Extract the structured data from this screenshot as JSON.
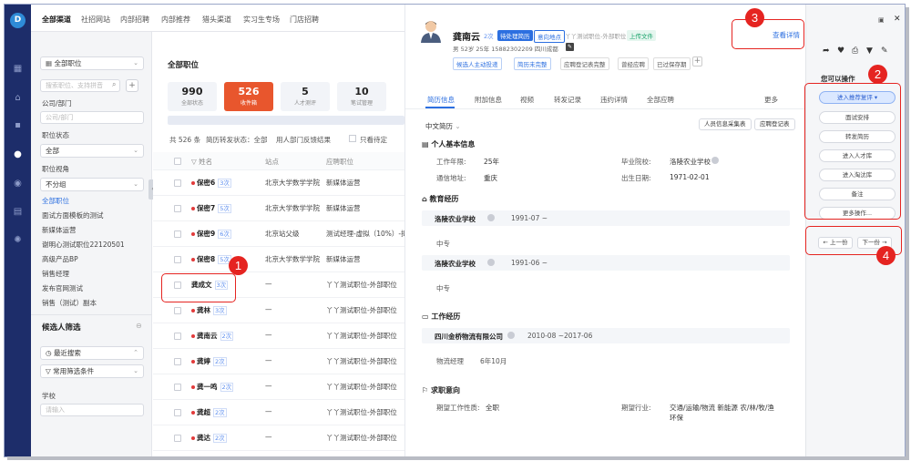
{
  "top_tabs": [
    "全部渠道",
    "社招网站",
    "内部招聘",
    "内部推荐",
    "猎头渠道",
    "实习生专场",
    "门店招聘"
  ],
  "filter": {
    "job_select": "全部职位",
    "search_placeholder": "搜索职位、支持拼音",
    "company_label": "公司/部门",
    "company_placeholder": "公司/部门",
    "status_label": "职位状态",
    "status_value": "全部",
    "view_label": "职位视角",
    "view_value": "不分组",
    "positions": [
      "全部职位",
      "面试方面模板的测试",
      "新媒体运营",
      "谢明心测试职位22120501",
      "高级产品BP",
      "销售经理",
      "发布官网测试",
      "销售（测试）副本"
    ],
    "candidate_filter_title": "候选人筛选",
    "recent_search": "最近搜索",
    "common_filter": "常用筛选条件",
    "school_label": "学校",
    "school_placeholder": "请输入"
  },
  "list": {
    "title": "全部职位",
    "stats": [
      {
        "num": "990",
        "label": "全部状态"
      },
      {
        "num": "526",
        "label": "收件箱"
      },
      {
        "num": "5",
        "label": "人才测评"
      },
      {
        "num": "10",
        "label": "笔试管理"
      }
    ],
    "summary": "共 526 条",
    "filter_text": "简历转发状态：全部",
    "filter_text2": "用人部门反馈结果",
    "pending_text": "只看待定",
    "headers": {
      "name": "姓名",
      "site": "站点",
      "job": "应聘职位"
    },
    "rows": [
      {
        "name": "保密6",
        "badge": "3次",
        "school": "北京大学数学学院",
        "job": "新媒体运营",
        "dot": true
      },
      {
        "name": "保密7",
        "badge": "5次",
        "school": "北京大学数学学院",
        "job": "新媒体运营",
        "dot": true
      },
      {
        "name": "保密9",
        "badge": "6次",
        "school": "北京站父级",
        "job": "测试经理-虚拟（10%）-拟",
        "dot": true
      },
      {
        "name": "保密8",
        "badge": "5次",
        "school": "北京大学数学学院",
        "job": "新媒体运营",
        "dot": true
      },
      {
        "name": "龚成文",
        "badge": "3次",
        "school": "—",
        "job": "丫丫测试职位-外部职位",
        "dot": false
      },
      {
        "name": "龚林",
        "badge": "3次",
        "school": "—",
        "job": "丫丫测试职位-外部职位",
        "dot": true
      },
      {
        "name": "龚南云",
        "badge": "2次",
        "school": "—",
        "job": "丫丫测试职位-外部职位",
        "dot": true
      },
      {
        "name": "龚婷",
        "badge": "2次",
        "school": "—",
        "job": "丫丫测试职位-外部职位",
        "dot": true
      },
      {
        "name": "龚一鸣",
        "badge": "2次",
        "school": "—",
        "job": "丫丫测试职位-外部职位",
        "dot": true
      },
      {
        "name": "龚超",
        "badge": "2次",
        "school": "—",
        "job": "丫丫测试职位-外部职位",
        "dot": true
      },
      {
        "name": "龚达",
        "badge": "2次",
        "school": "—",
        "job": "丫丫测试职位-外部职位",
        "dot": true
      }
    ]
  },
  "detail": {
    "name": "龚南云",
    "count": "2次",
    "status_tag": "待处理简历",
    "intent_tag": "意向地点",
    "job_text": "丫丫测试职位-外部职位",
    "upload_tag": "上传文件",
    "meta": "男  52岁  25年  15882302209  四川成都",
    "actions": [
      "候选人主动投递",
      "简历未完整",
      "应聘登记表完整",
      "曾经应聘",
      "已过保存期"
    ],
    "view_detail": "查看详情",
    "tabs": [
      "简历信息",
      "附加信息",
      "视频",
      "转发记录",
      "违约详情",
      "全部应聘"
    ],
    "more": "更多",
    "lang_select": "中文简历",
    "btn_collect": "人员信息采集表",
    "btn_register": "应聘登记表",
    "basic_title": "个人基本信息",
    "work_years_label": "工作年限:",
    "work_years": "25年",
    "school_label": "毕业院校:",
    "school": "洛陵农业学校",
    "address_label": "通信地址:",
    "address": "重庆",
    "birth_label": "出生日期:",
    "birth": "1971-02-01",
    "edu_title": "教育经历",
    "edu": [
      {
        "school": "洛陵农业学校",
        "date": "1991-07 ~",
        "degree": "中专"
      },
      {
        "school": "洛陵农业学校",
        "date": "1991-06 ~",
        "degree": "中专"
      }
    ],
    "work_title": "工作经历",
    "work_company": "四川金桥物流有限公司",
    "work_date": "2010-08 ~2017-06",
    "work_role": "物流经理",
    "work_duration": "6年10月",
    "intent_title": "求职意向",
    "intent_type_label": "期望工作性质:",
    "intent_type": "全职",
    "intent_industry_label": "期望行业:",
    "intent_industry": "交通/运输/物流 新能源 农/林/牧/渔",
    "intent_industry2": "环保"
  },
  "right_panel": {
    "ops_title": "您可以操作",
    "buttons": [
      "进入推荐复评",
      "面试安排",
      "转发简历",
      "进入人才库",
      "进入淘汰库",
      "备注",
      "更多操作..."
    ],
    "prev": "上一份",
    "next": "下一份"
  },
  "annotations": [
    "1",
    "2",
    "3",
    "4"
  ]
}
